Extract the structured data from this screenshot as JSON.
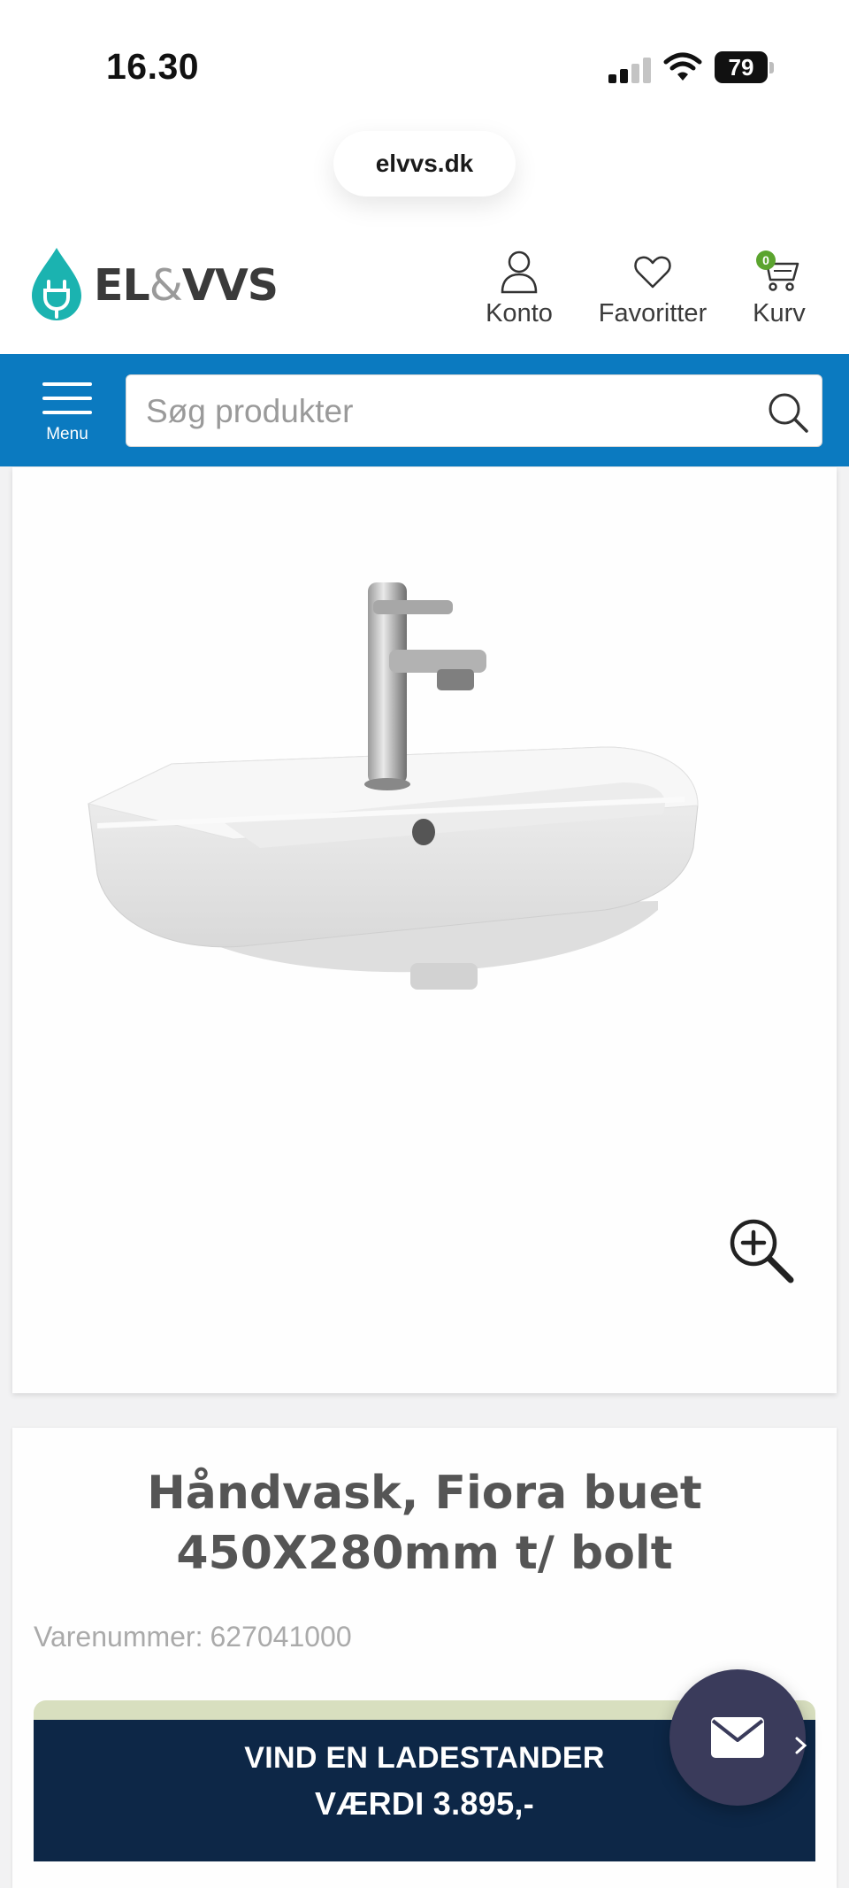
{
  "status_bar": {
    "time": "16.30",
    "battery_level": "79"
  },
  "browser": {
    "url": "elvvs.dk"
  },
  "header": {
    "logo": {
      "text_left": "EL",
      "text_amp": "&",
      "text_right": "VVS"
    },
    "account_label": "Konto",
    "favorites_label": "Favoritter",
    "cart_label": "Kurv",
    "cart_count": "0",
    "colors": {
      "brand_teal": "#1bb3b0",
      "brand_green": "#5ba42e"
    }
  },
  "searchbar": {
    "menu_label": "Menu",
    "placeholder": "Søg produkter",
    "value": "",
    "colors": {
      "bar": "#0b7ac0"
    }
  },
  "product": {
    "title": "Håndvask, Fiora buet 450X280mm t/ bolt",
    "sku_label": "Varenummer:",
    "sku_value": "627041000",
    "image_icon": "zoom-in-icon"
  },
  "promo": {
    "line1": "VIND EN LADESTANDER",
    "line2": "VÆRDI 3.895,-",
    "colors": {
      "background": "#0d2747"
    }
  },
  "chat": {
    "icon": "mail-icon"
  }
}
